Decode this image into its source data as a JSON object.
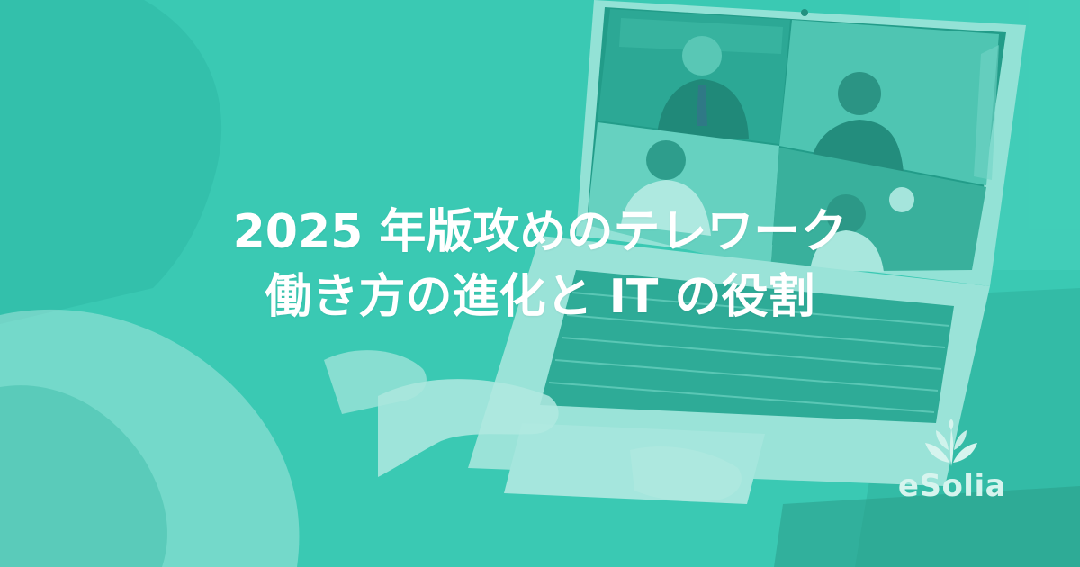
{
  "headline": {
    "line1": "2025 年版攻めのテレワーク",
    "line2": "働き方の進化と IT の役割"
  },
  "brand": {
    "name": "eSolia",
    "logo_icon": "leaf-sprout-icon"
  },
  "colors": {
    "overlay_teal": "#3fcab4",
    "headline_text": "#ffffff",
    "brand_text": "#d6f4ee"
  },
  "background": {
    "scene": "video-call-on-laptop",
    "video_tiles": 4
  }
}
